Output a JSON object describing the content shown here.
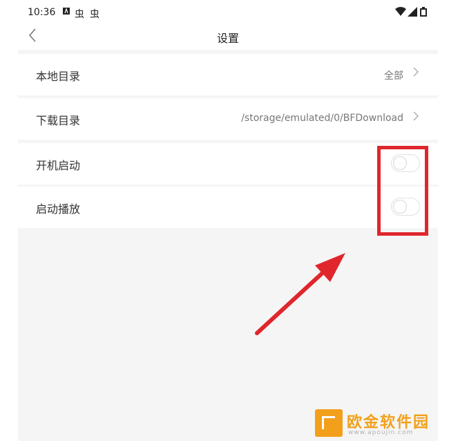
{
  "status_bar": {
    "time": "10:36",
    "icons": [
      "notification-a-icon",
      "bug-icon",
      "bug-icon"
    ],
    "right_icons": [
      "wifi-icon",
      "signal-icon",
      "battery-icon"
    ]
  },
  "header": {
    "title": "设置",
    "back_icon": "chevron-left-icon"
  },
  "settings": [
    {
      "label": "本地目录",
      "value": "全部",
      "type": "link"
    },
    {
      "label": "下载目录",
      "value": "/storage/emulated/0/BFDownload",
      "type": "link"
    },
    {
      "label": "开机启动",
      "type": "toggle",
      "on": false
    },
    {
      "label": "启动播放",
      "type": "toggle",
      "on": false
    }
  ],
  "annotation": {
    "color": "#e0262d"
  },
  "watermark": {
    "text": "欧金软件园",
    "url": "www.apoujin.com",
    "color": "#f2a01b"
  }
}
